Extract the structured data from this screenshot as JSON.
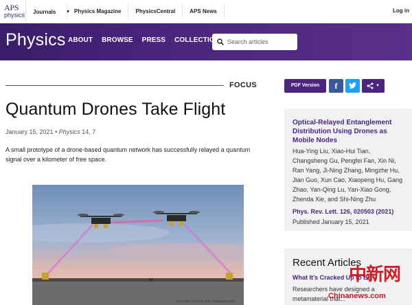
{
  "topbar": {
    "logo_line1": "APS",
    "logo_line2": "physics",
    "journals_label": "Journals",
    "nav": [
      "Physics Magazine",
      "PhysicsCentral",
      "APS News"
    ],
    "login_label": "Log in"
  },
  "header": {
    "brand": "Physics",
    "nav": [
      "ABOUT",
      "BROWSE",
      "PRESS",
      "COLLECTIONS"
    ],
    "search_placeholder": "Search articles"
  },
  "article": {
    "section": "FOCUS",
    "pdf_label": "PDF Version",
    "title": "Quantum Drones Take Flight",
    "date": "January 15, 2021",
    "separator": "•",
    "journal": "Physics",
    "volume": "14, 7",
    "lede": "A small prototype of a drone-based quantum network has successfully relayed a quantum signal over a kilometer of free space.",
    "image_credit": "X.-H. Tian, H.-Y. Liu, & Z. Xie/Nanjing Univ."
  },
  "sidebar": {
    "paper_title": "Optical-Relayed Entanglement Distribution Using Drones as Mobile Nodes",
    "authors": "Hua-Ying Liu, Xiao-Hui Tian, Changsheng Gu, Pengfei Fan, Xin Ni, Ran Yang, Ji-Ning Zhang, Mingzhe Hu, Jian Guo, Xun Cao, Xiaopeng Hu, Gang Zhao, Yan-Qing Lu, Yan-Xiao Gong, Zhenda Xie, and Shi-Ning Zhu",
    "reference": "Phys. Rev. Lett. 126, 020503 (2021)",
    "published": "Published January 15, 2021",
    "recent_heading": "Recent Articles",
    "recent_link": "What It’s Cracked Up to Be",
    "recent_text": "Researchers have designed a metamaterial that..."
  },
  "watermark": {
    "cn": "中新网",
    "en": "Chinanews.com"
  },
  "colors": {
    "brand_purple": "#4b267e",
    "header_dark": "#3a1d6b",
    "facebook": "#3b5998",
    "twitter": "#1da1f2",
    "watermark_red": "#c8161d"
  }
}
